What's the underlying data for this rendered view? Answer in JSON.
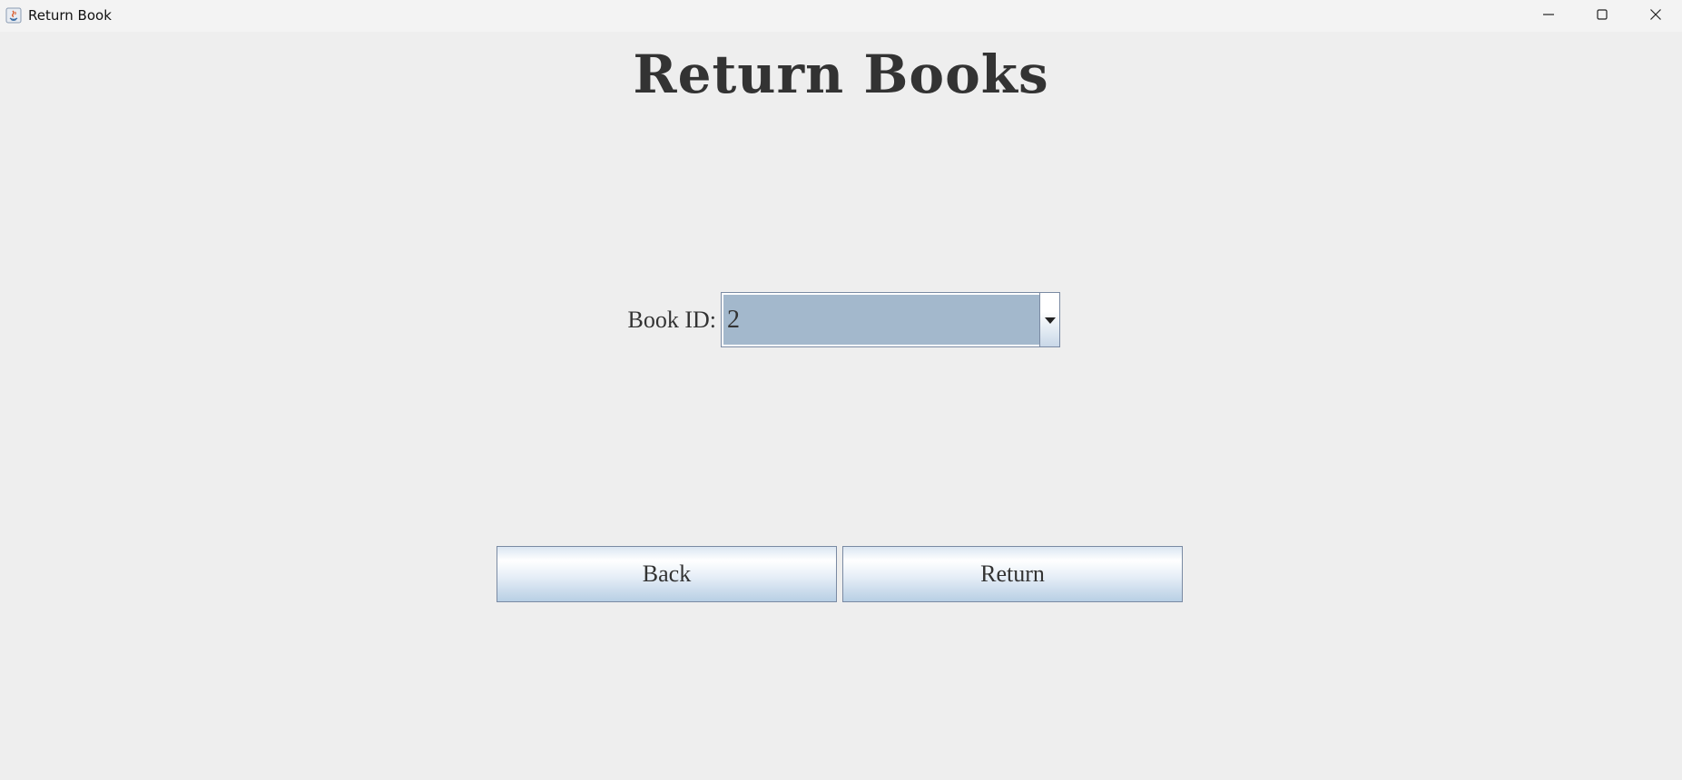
{
  "window": {
    "title": "Return Book",
    "icons": {
      "app": "java-app-icon",
      "minimize": "minimize-icon",
      "maximize": "maximize-icon",
      "close": "close-icon"
    }
  },
  "form": {
    "heading": "Return Books",
    "book_id_label": "Book ID:",
    "book_id_selected": "2",
    "dropdown_icon": "chevron-down-icon"
  },
  "actions": {
    "back_label": "Back",
    "return_label": "Return"
  },
  "colors": {
    "background": "#eeeeee",
    "combo_selection": "#a3b8cc",
    "text": "#333333",
    "border": "#7a8aa3"
  }
}
